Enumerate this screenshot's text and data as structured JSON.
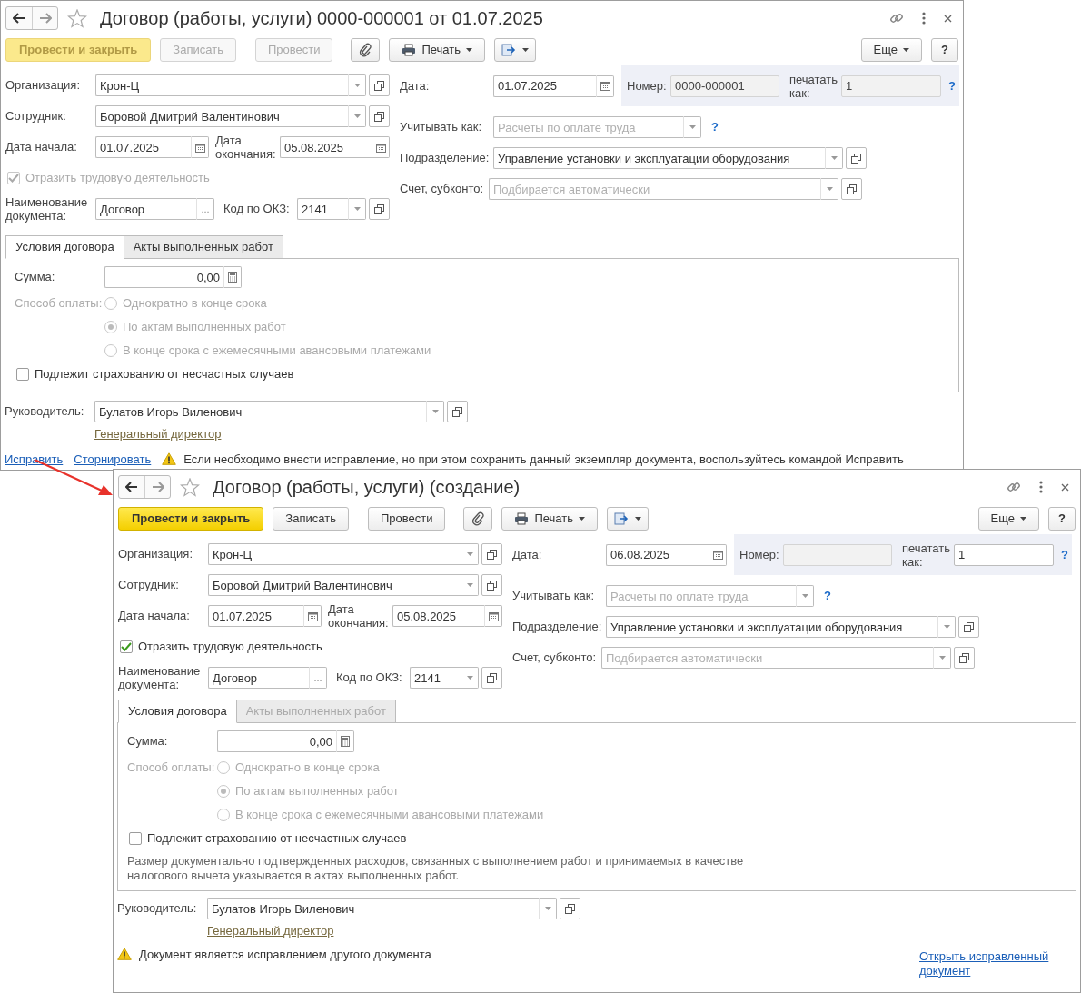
{
  "windows": [
    {
      "title": "Договор (работы, услуги) 0000-000001 от 01.07.2025",
      "toolbar": {
        "buttons": [
          {
            "kind": "primary",
            "label": "Провести и закрыть",
            "disabled": true
          },
          {
            "kind": "plain",
            "label": "Записать",
            "disabled": true
          },
          {
            "kind": "plain",
            "label": "Провести",
            "disabled": true
          },
          {
            "kind": "attach"
          },
          {
            "kind": "print",
            "label": "Печать"
          },
          {
            "kind": "export"
          }
        ],
        "more": "Еще",
        "help": "?"
      },
      "organization": {
        "label": "Организация:",
        "value": "Крон-Ц"
      },
      "employee": {
        "label": "Сотрудник:",
        "value": "Боровой Дмитрий Валентинович"
      },
      "start_date": {
        "label": "Дата начала:",
        "value": "01.07.2025"
      },
      "end_date": {
        "label": "Дата окончания:",
        "value": "05.08.2025"
      },
      "reflect_work": {
        "label": "Отразить трудовую деятельность",
        "checked": true,
        "disabled": true
      },
      "document_name": {
        "label": "Наименование документа:",
        "value": "Договор",
        "button": "..."
      },
      "okz_code": {
        "label": "Код по ОКЗ:",
        "value": "2141"
      },
      "date": {
        "label": "Дата:",
        "value": "01.07.2025"
      },
      "number": {
        "label": "Номер:",
        "value": "0000-000001",
        "disabled": true
      },
      "print_as": {
        "label": "печатать как:",
        "value": "1",
        "disabled": true,
        "help": "?"
      },
      "account_as": {
        "label": "Учитывать как:",
        "placeholder": "Расчеты по оплате труда",
        "help": "?"
      },
      "department": {
        "label": "Подразделение:",
        "value": "Управление установки и эксплуатации оборудования"
      },
      "account": {
        "label": "Счет, субконто:",
        "placeholder": "Подбирается автоматически"
      },
      "tabs": [
        {
          "label": "Условия договора",
          "selected": true,
          "disabled": false
        },
        {
          "label": "Акты выполненных работ",
          "selected": false,
          "disabled": false
        }
      ],
      "sum": {
        "label": "Сумма:",
        "value": "0,00"
      },
      "payment": {
        "label": "Способ оплаты:",
        "disabled": true,
        "options": [
          {
            "label": "Однократно в конце срока",
            "selected": false
          },
          {
            "label": "По актам выполненных работ",
            "selected": true
          },
          {
            "label": "В конце срока с ежемесячными авансовыми платежами",
            "selected": false
          }
        ]
      },
      "insurance": {
        "label": "Подлежит страхованию от несчастных случаев",
        "checked": false
      },
      "head": {
        "label": "Руководитель:",
        "value": "Булатов Игорь Виленович",
        "position": "Генеральный директор"
      },
      "footer": {
        "links": [
          "Исправить",
          "Сторнировать"
        ],
        "warning": "Если необходимо внести исправление, но при этом сохранить данный экземпляр документа, воспользуйтесь командой Исправить"
      }
    },
    {
      "title": "Договор (работы, услуги) (создание)",
      "toolbar": {
        "buttons": [
          {
            "kind": "primary",
            "label": "Провести и закрыть",
            "disabled": false
          },
          {
            "kind": "plain",
            "label": "Записать",
            "disabled": false
          },
          {
            "kind": "plain",
            "label": "Провести",
            "disabled": false
          },
          {
            "kind": "attach"
          },
          {
            "kind": "print",
            "label": "Печать"
          },
          {
            "kind": "export"
          }
        ],
        "more": "Еще",
        "help": "?"
      },
      "organization": {
        "label": "Организация:",
        "value": "Крон-Ц"
      },
      "employee": {
        "label": "Сотрудник:",
        "value": "Боровой Дмитрий Валентинович"
      },
      "start_date": {
        "label": "Дата начала:",
        "value": "01.07.2025"
      },
      "end_date": {
        "label": "Дата окончания:",
        "value": "05.08.2025"
      },
      "reflect_work": {
        "label": "Отразить трудовую деятельность",
        "checked": true,
        "disabled": false
      },
      "document_name": {
        "label": "Наименование документа:",
        "value": "Договор",
        "button": "..."
      },
      "okz_code": {
        "label": "Код по ОКЗ:",
        "value": "2141"
      },
      "date": {
        "label": "Дата:",
        "value": "06.08.2025"
      },
      "number": {
        "label": "Номер:",
        "disabled": true
      },
      "print_as": {
        "label": "печатать как:",
        "value": "1",
        "disabled": false,
        "help": "?"
      },
      "account_as": {
        "label": "Учитывать как:",
        "placeholder": "Расчеты по оплате труда",
        "help": "?"
      },
      "department": {
        "label": "Подразделение:",
        "value": "Управление установки и эксплуатации оборудования"
      },
      "account": {
        "label": "Счет, субконто:",
        "placeholder": "Подбирается автоматически"
      },
      "tabs": [
        {
          "label": "Условия договора",
          "selected": true,
          "disabled": false
        },
        {
          "label": "Акты выполненных работ",
          "selected": false,
          "disabled": true
        }
      ],
      "sum": {
        "label": "Сумма:",
        "value": "0,00"
      },
      "payment": {
        "label": "Способ оплаты:",
        "disabled": true,
        "options": [
          {
            "label": "Однократно в конце срока",
            "selected": false
          },
          {
            "label": "По актам выполненных работ",
            "selected": true
          },
          {
            "label": "В конце срока с ежемесячными авансовыми платежами",
            "selected": false
          }
        ]
      },
      "insurance": {
        "label": "Подлежит страхованию от несчастных случаев",
        "checked": false
      },
      "note": "Размер документально подтвержденных расходов, связанных с выполнением работ и принимаемых в качестве налогового вычета указывается в актах выполненных работ.",
      "head": {
        "label": "Руководитель:",
        "value": "Булатов Игорь Виленович",
        "position": "Генеральный директор"
      },
      "footer": {
        "warning": "Документ является исправлением другого документа",
        "open_link": "Открыть исправленный документ"
      }
    }
  ]
}
